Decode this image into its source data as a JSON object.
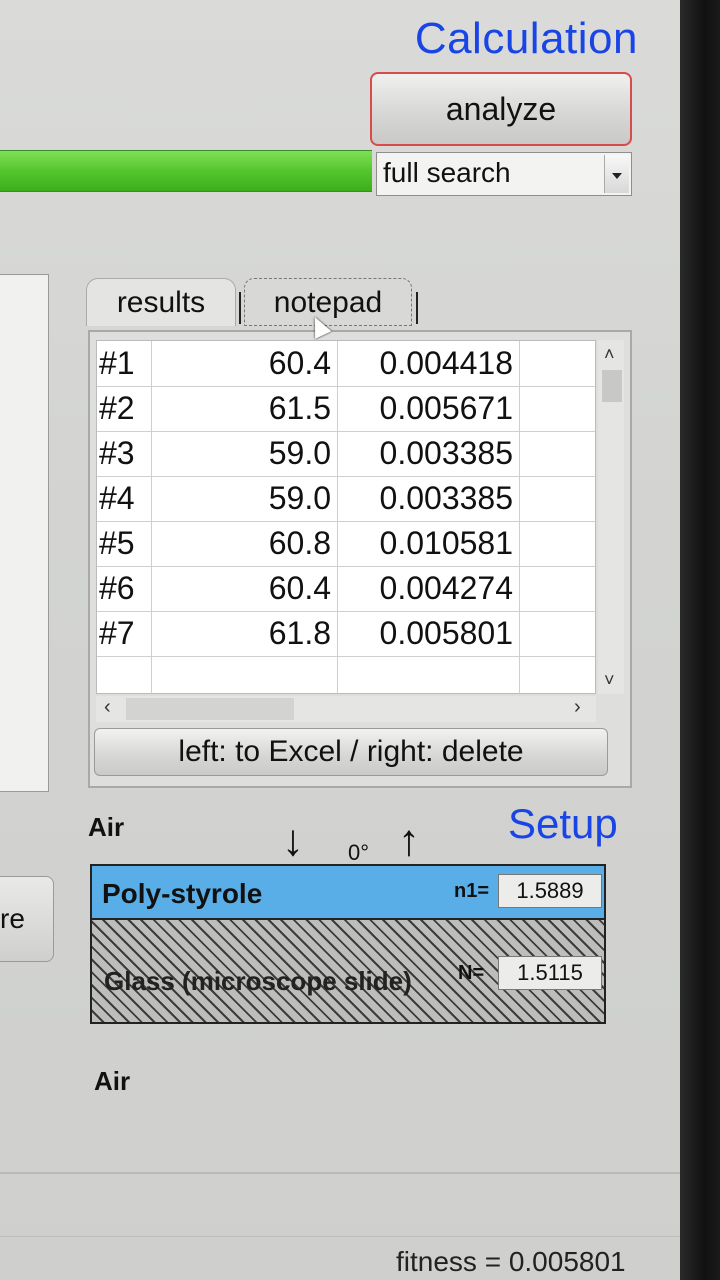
{
  "header": {
    "title": "Calculation",
    "analyze_label": "analyze",
    "progress_percent": 100,
    "search_mode": "full search"
  },
  "left_panel": {
    "button_partial_label": "re"
  },
  "tabs": [
    {
      "label": "results",
      "active": true
    },
    {
      "label": "notepad",
      "active": false
    }
  ],
  "results": {
    "rows": [
      {
        "id": "#1",
        "angle": "60.4",
        "fitness": "0.004418"
      },
      {
        "id": "#2",
        "angle": "61.5",
        "fitness": "0.005671"
      },
      {
        "id": "#3",
        "angle": "59.0",
        "fitness": "0.003385"
      },
      {
        "id": "#4",
        "angle": "59.0",
        "fitness": "0.003385"
      },
      {
        "id": "#5",
        "angle": "60.8",
        "fitness": "0.010581"
      },
      {
        "id": "#6",
        "angle": "60.4",
        "fitness": "0.004274"
      },
      {
        "id": "#7",
        "angle": "61.8",
        "fitness": "0.005801"
      }
    ],
    "excel_button_label": "left: to Excel / right: delete"
  },
  "setup": {
    "title": "Setup",
    "top_medium": "Air",
    "bottom_medium": "Air",
    "angle_label": "0°",
    "down_arrow": "↓",
    "up_arrow": "↑",
    "layers": [
      {
        "name": "Poly-styrole",
        "n_label": "n1=",
        "n_value": "1.5889",
        "color": "#5aaee8"
      },
      {
        "name": "Glass (microscope slide)",
        "n_label": "N=",
        "n_value": "1.5115",
        "pattern": "hatched"
      }
    ]
  },
  "status": {
    "fitness_text": "fitness = 0.005801"
  },
  "colors": {
    "accent_blue": "#1a45e6",
    "progress_green": "#54c62d",
    "analyze_border": "#d94a4a"
  }
}
